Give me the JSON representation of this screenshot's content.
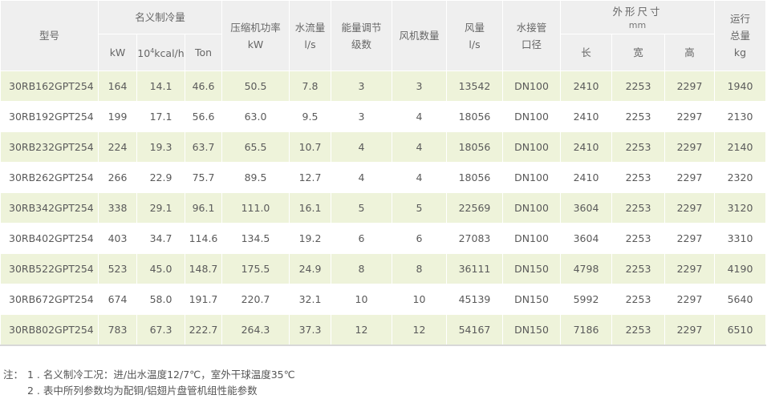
{
  "headers": {
    "model": "型号",
    "cooling": "名义制冷量",
    "cooling_kw": "kW",
    "cooling_kcal_base": "10",
    "cooling_kcal_exp": "4",
    "cooling_kcal_unit": "kcal/h",
    "cooling_ton": "Ton",
    "compressor": "压缩机功率",
    "compressor_unit": "kW",
    "water_flow": "水流量",
    "water_flow_unit": "l/s",
    "capacity_steps_l1": "能量调节",
    "capacity_steps_l2": "级数",
    "fans": "风机数量",
    "airflow": "风量",
    "airflow_unit": "l/s",
    "water_pipe_l1": "水接管",
    "water_pipe_l2": "口径",
    "dimensions": "外形尺寸",
    "dimensions_unit": "mm",
    "length": "长",
    "width": "宽",
    "height": "高",
    "weight_l1": "运行",
    "weight_l2": "总量",
    "weight_unit": "kg"
  },
  "rows": [
    [
      "30RB162GPT254",
      "164",
      "14.1",
      "46.6",
      "50.5",
      "7.8",
      "3",
      "3",
      "13542",
      "DN100",
      "2410",
      "2253",
      "2297",
      "1940"
    ],
    [
      "30RB192GPT254",
      "199",
      "17.1",
      "56.6",
      "63.0",
      "9.5",
      "3",
      "4",
      "18056",
      "DN100",
      "2410",
      "2253",
      "2297",
      "2130"
    ],
    [
      "30RB232GPT254",
      "224",
      "19.3",
      "63.7",
      "65.5",
      "10.7",
      "4",
      "4",
      "18056",
      "DN100",
      "2410",
      "2253",
      "2297",
      "2140"
    ],
    [
      "30RB262GPT254",
      "266",
      "22.9",
      "75.7",
      "89.5",
      "12.7",
      "4",
      "4",
      "18056",
      "DN100",
      "2410",
      "2253",
      "2297",
      "2320"
    ],
    [
      "30RB342GPT254",
      "338",
      "29.1",
      "96.1",
      "111.0",
      "16.1",
      "5",
      "5",
      "22569",
      "DN100",
      "3604",
      "2253",
      "2297",
      "3120"
    ],
    [
      "30RB402GPT254",
      "403",
      "34.7",
      "114.6",
      "134.5",
      "19.2",
      "6",
      "6",
      "27083",
      "DN100",
      "3604",
      "2253",
      "2297",
      "3310"
    ],
    [
      "30RB522GPT254",
      "523",
      "45.0",
      "148.7",
      "175.5",
      "24.9",
      "8",
      "8",
      "36111",
      "DN150",
      "4798",
      "2253",
      "2297",
      "4190"
    ],
    [
      "30RB672GPT254",
      "674",
      "58.0",
      "191.7",
      "220.7",
      "32.1",
      "10",
      "10",
      "45139",
      "DN150",
      "5992",
      "2253",
      "2297",
      "5640"
    ],
    [
      "30RB802GPT254",
      "783",
      "67.3",
      "222.7",
      "264.3",
      "37.3",
      "12",
      "12",
      "54167",
      "DN150",
      "7186",
      "2253",
      "2297",
      "6510"
    ]
  ],
  "notes": {
    "label": "注：",
    "items": [
      "1 . 名义制冷工况：进/出水温度12/7℃，室外干球温度35℃",
      "2 . 表中所列参数均为配铜/铝翅片盘管机组性能参数"
    ]
  },
  "colors": {
    "header_bg": "#efefef",
    "row_highlight": "#eef3da",
    "text": "#555555"
  }
}
